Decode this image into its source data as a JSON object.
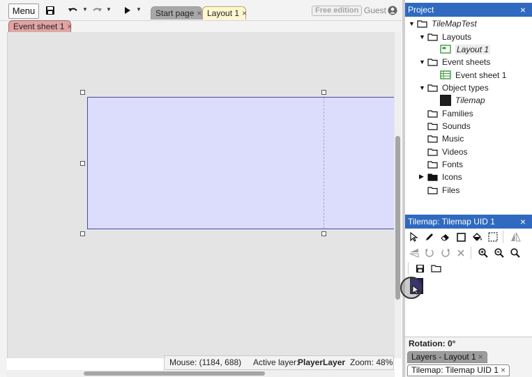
{
  "toolbar": {
    "menu_label": "Menu",
    "save_icon": "save-icon",
    "undo_icon": "undo-icon",
    "redo_icon": "redo-icon",
    "play_icon": "play-icon",
    "tabs": [
      {
        "label": "Start page",
        "close": "×"
      },
      {
        "label": "Layout 1",
        "close": "×"
      }
    ],
    "free_edition_label": "Free edition",
    "guest_label": "Guest"
  },
  "secondary_tabs": [
    {
      "label": "Event sheet 1",
      "close": "×"
    }
  ],
  "status_bar": {
    "mouse": "Mouse: (1184, 688)",
    "active_layer_label": "Active layer:",
    "active_layer_value": "PlayerLayer",
    "zoom": "Zoom: 48%"
  },
  "project_panel": {
    "title": "Project",
    "close": "×",
    "root": "TileMapTest",
    "items": [
      {
        "label": "Layouts"
      },
      {
        "label": "Layout 1"
      },
      {
        "label": "Event sheets"
      },
      {
        "label": "Event sheet 1"
      },
      {
        "label": "Object types"
      },
      {
        "label": "Tilemap"
      },
      {
        "label": "Families"
      },
      {
        "label": "Sounds"
      },
      {
        "label": "Music"
      },
      {
        "label": "Videos"
      },
      {
        "label": "Fonts"
      },
      {
        "label": "Icons"
      },
      {
        "label": "Files"
      }
    ]
  },
  "tilemap_panel": {
    "title": "Tilemap: Tilemap UID 1",
    "close": "×",
    "tile_color": "#1e1a6e",
    "rotation": "Rotation: 0°"
  },
  "bottom_tabs": [
    {
      "label": "Layers - Layout 1",
      "close": "×"
    },
    {
      "label": "Tilemap: Tilemap UID 1",
      "close": "×"
    }
  ]
}
